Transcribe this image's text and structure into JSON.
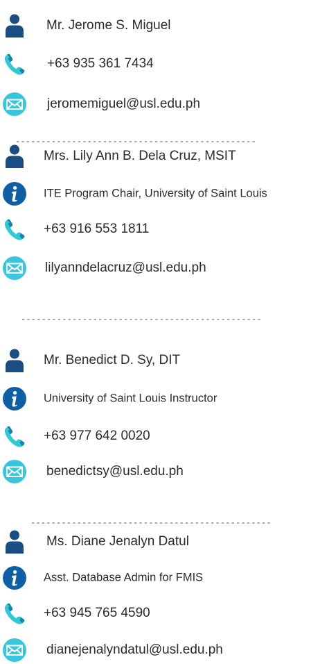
{
  "colors": {
    "person_icon": "#1a4d82",
    "info_icon": "#0f5fa6",
    "phone_icon_light": "#31c9d8",
    "phone_icon_dark": "#1784a8",
    "mail_icon_bg": "#39c6dd",
    "text": "#2b2b2b"
  },
  "separator": "-----------------------------------------------",
  "contacts": [
    {
      "name": "Mr. Jerome S. Miguel",
      "phone": "+63 935 361 7434",
      "email": "jeromemiguel@usl.edu.ph"
    },
    {
      "name": "Mrs. Lily Ann B. Dela Cruz, MSIT",
      "role": "ITE Program Chair, University of Saint Louis",
      "phone": "+63 916 553 1811",
      "email": "lilyanndelacruz@usl.edu.ph"
    },
    {
      "name": "Mr. Benedict D. Sy, DIT",
      "role": "University of Saint Louis Instructor",
      "phone": "+63 977 642 0020",
      "email": "benedictsy@usl.edu.ph"
    },
    {
      "name": "Ms. Diane Jenalyn Datul",
      "role": "Asst. Database Admin for FMIS",
      "phone": "+63 945 765 4590",
      "email": "dianejenalyndatul@usl.edu.ph"
    }
  ]
}
